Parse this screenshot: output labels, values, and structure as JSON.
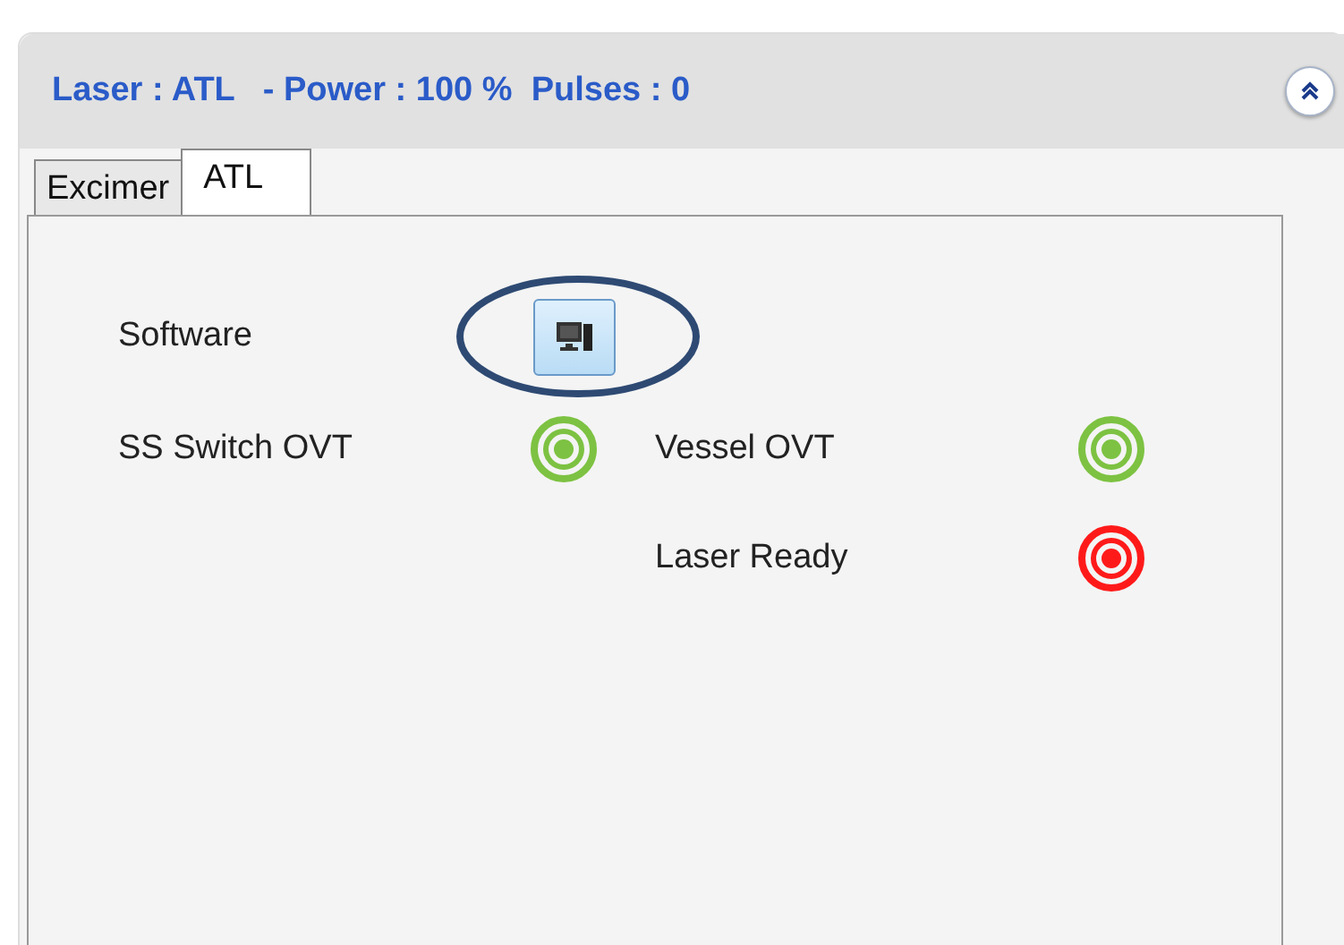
{
  "header": {
    "title": "Laser : ATL   - Power : 100 %  Pulses : 0"
  },
  "tabs": [
    {
      "label": "Excimer",
      "selected": false
    },
    {
      "label": "ATL",
      "selected": true
    }
  ],
  "software": {
    "label": "Software",
    "highlighted": true
  },
  "left_indicators": [
    {
      "label": "SS Switch OVT",
      "color": "#7dc242"
    }
  ],
  "right_indicators": [
    {
      "label": "Vessel OVT",
      "color": "#7dc242"
    },
    {
      "label": "Laser Ready",
      "color": "#ff1a1a"
    }
  ]
}
